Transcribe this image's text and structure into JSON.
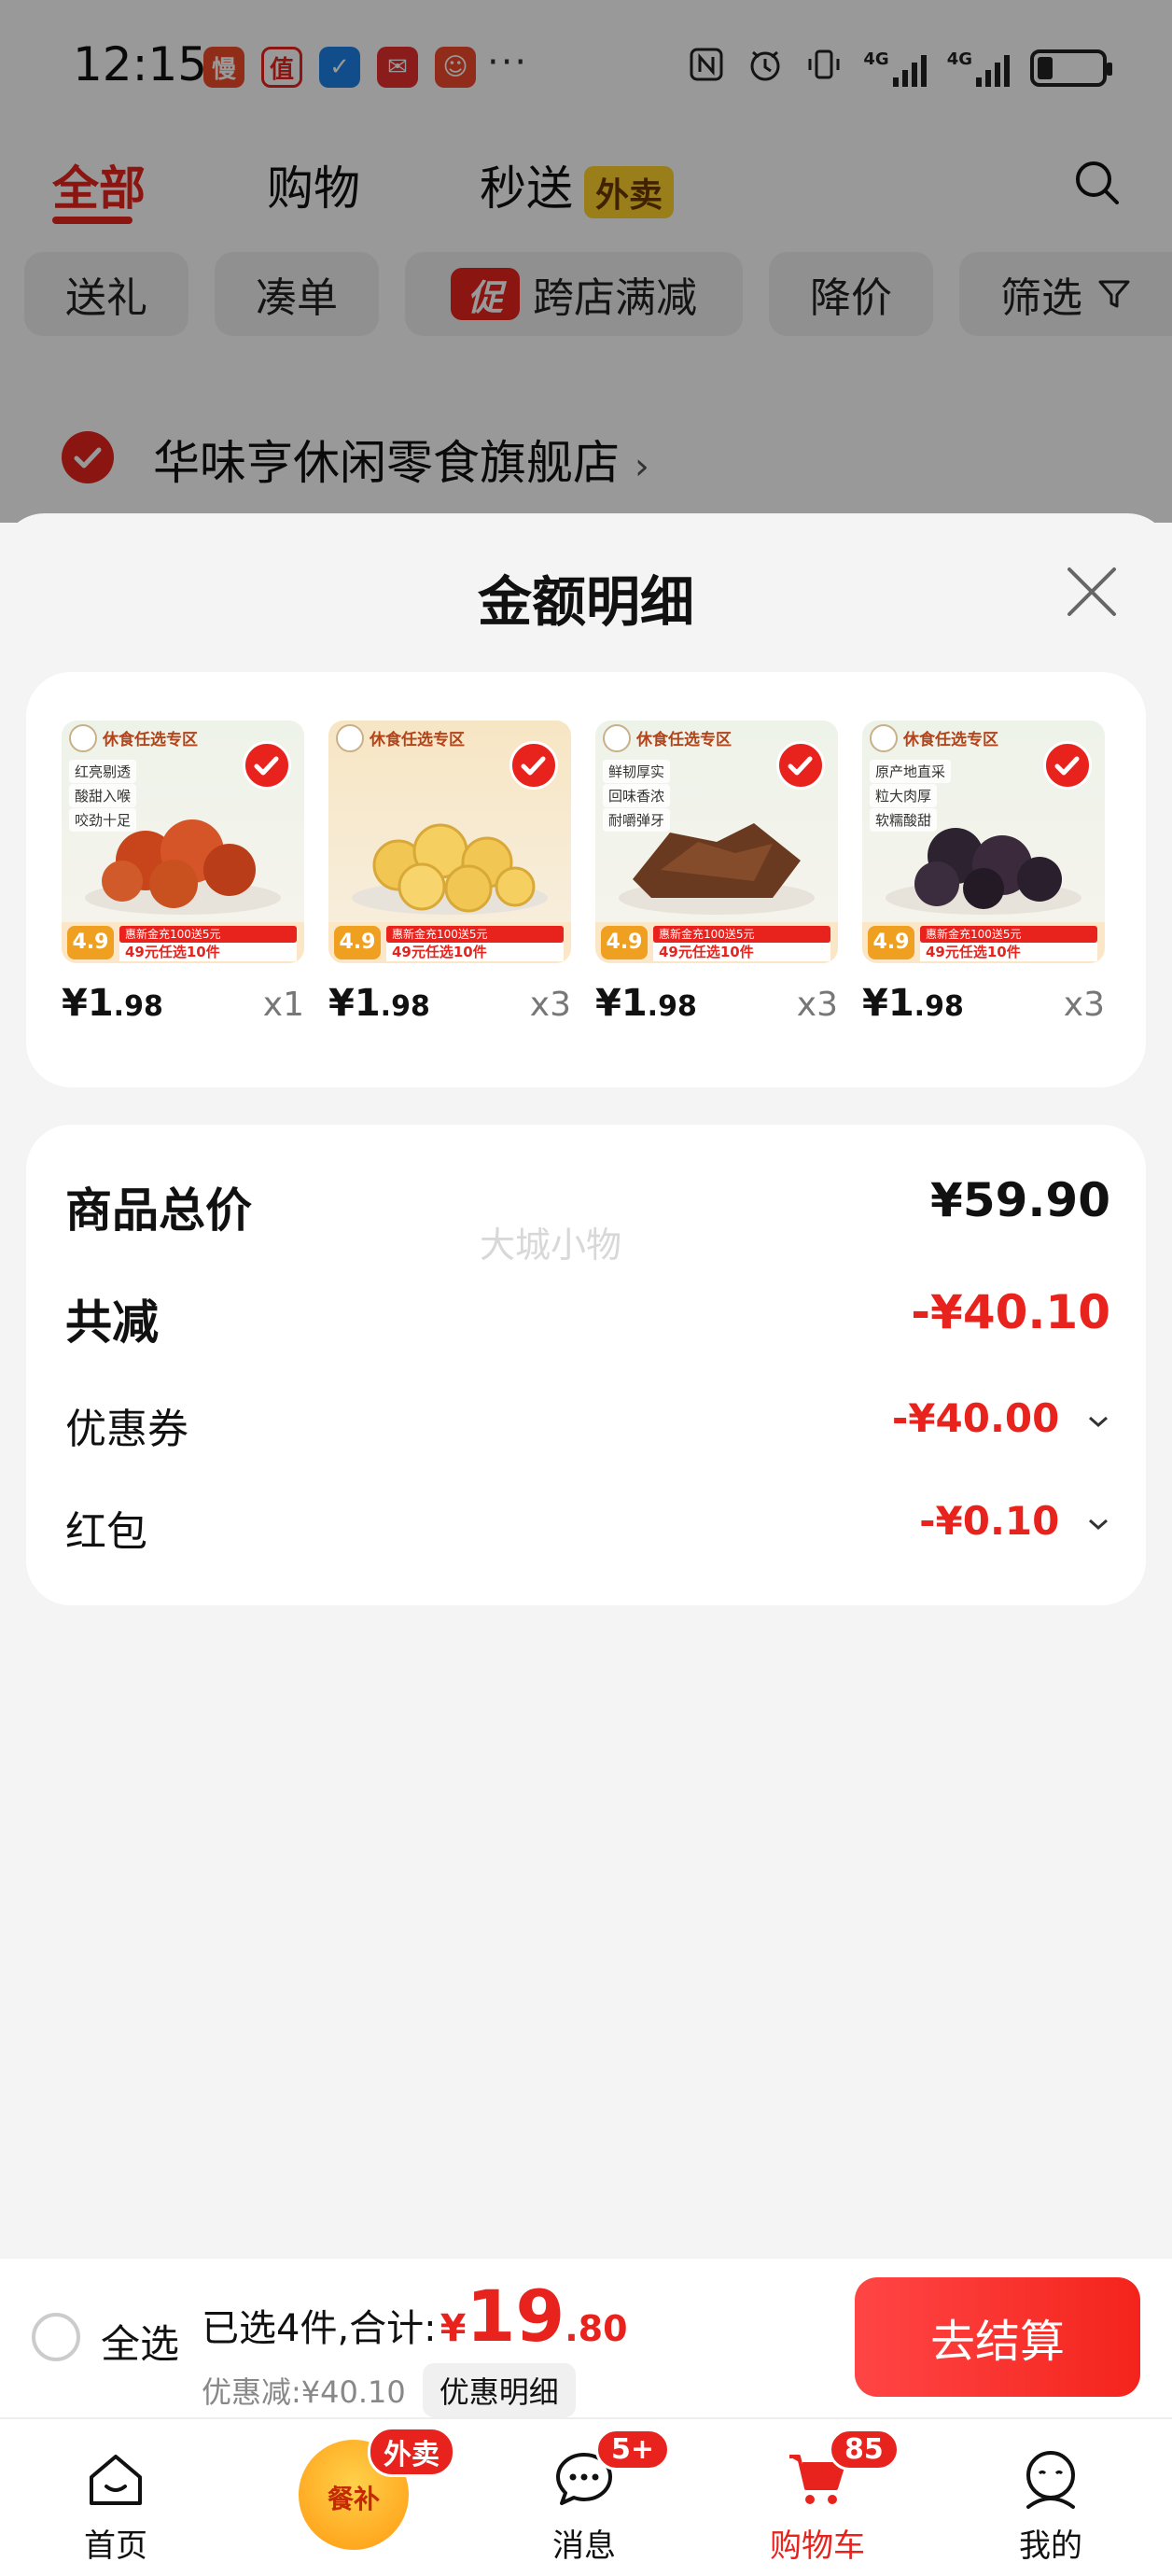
{
  "status_bar": {
    "time": "12:15",
    "app_icons": [
      {
        "name": "man-app-icon",
        "glyph": "慢",
        "color": "#ef4b2a"
      },
      {
        "name": "zhi-app-icon",
        "glyph": "值",
        "color": "#e8231d"
      },
      {
        "name": "blue-app-icon",
        "glyph": "✓",
        "color": "#1d7fe8"
      },
      {
        "name": "mail-app-icon",
        "glyph": "✉",
        "color": "#e83030"
      },
      {
        "name": "taobao-app-icon",
        "glyph": "☺",
        "color": "#f04a2a"
      }
    ],
    "more": "···",
    "net1": "4G",
    "net2": "4G"
  },
  "tabs": {
    "all": "全部",
    "shopping": "购物",
    "flash": "秒送",
    "flash_tag": "外卖"
  },
  "filters": [
    "送礼",
    "凑单",
    "跨店满减",
    "降价",
    "筛选"
  ],
  "promo_mark": "促",
  "store": {
    "name": "华味亨休闲零食旗舰店",
    "arrow": "›"
  },
  "sheet": {
    "title": "金额明细",
    "products": [
      {
        "zone": "休食任选专区",
        "features": [
          "红亮剔透",
          "酸甜入喉",
          "咬劲十足"
        ],
        "img_price": "4.9",
        "bar1": "惠新金充100送5元",
        "bar2": "49元任选10件",
        "price_int": "¥1",
        "price_dec": ".98",
        "qty": "x1",
        "food_color": "#c8451c"
      },
      {
        "zone": "休食任选专区",
        "features": [],
        "img_price": "4.9",
        "bar1": "惠新金充100送5元",
        "bar2": "49元任选10件",
        "price_int": "¥1",
        "price_dec": ".98",
        "qty": "x3",
        "food_color": "#f2c652"
      },
      {
        "zone": "休食任选专区",
        "features": [
          "鲜韧厚实",
          "回味香浓",
          "耐嚼弹牙"
        ],
        "img_price": "4.9",
        "bar1": "惠新金充100送5元",
        "bar2": "49元任选10件",
        "price_int": "¥1",
        "price_dec": ".98",
        "qty": "x3",
        "food_color": "#6a3a20"
      },
      {
        "zone": "休食任选专区",
        "features": [
          "原产地直采",
          "粒大肉厚",
          "软糯酸甜"
        ],
        "img_price": "4.9",
        "bar1": "惠新金充100送5元",
        "bar2": "49元任选10件",
        "price_int": "¥1",
        "price_dec": ".98",
        "qty": "x3",
        "food_color": "#2c2230"
      }
    ],
    "summary": {
      "total_label": "商品总价",
      "total_value": "¥59.90",
      "reduce_label": "共减",
      "reduce_value": "-¥40.10",
      "coupon_label": "优惠券",
      "coupon_value": "-¥40.00",
      "redpacket_label": "红包",
      "redpacket_value": "-¥0.10",
      "watermark": "大城小物"
    }
  },
  "checkout": {
    "select_all": "全选",
    "selected_text": "已选4件,合计:",
    "currency": "¥",
    "total_int": "19",
    "total_dec": ".80",
    "discount_text": "优惠减:¥40.10",
    "discount_detail": "优惠明细",
    "checkout_label": "去结算"
  },
  "nav": {
    "home": "首页",
    "meal_badge": "外卖",
    "meal_text": "餐补",
    "messages": "消息",
    "messages_badge": "5+",
    "cart": "购物车",
    "cart_badge": "85",
    "mine": "我的"
  },
  "colors": {
    "accent": "#e8231d",
    "background": "#f4f4f4",
    "card": "#ffffff"
  }
}
